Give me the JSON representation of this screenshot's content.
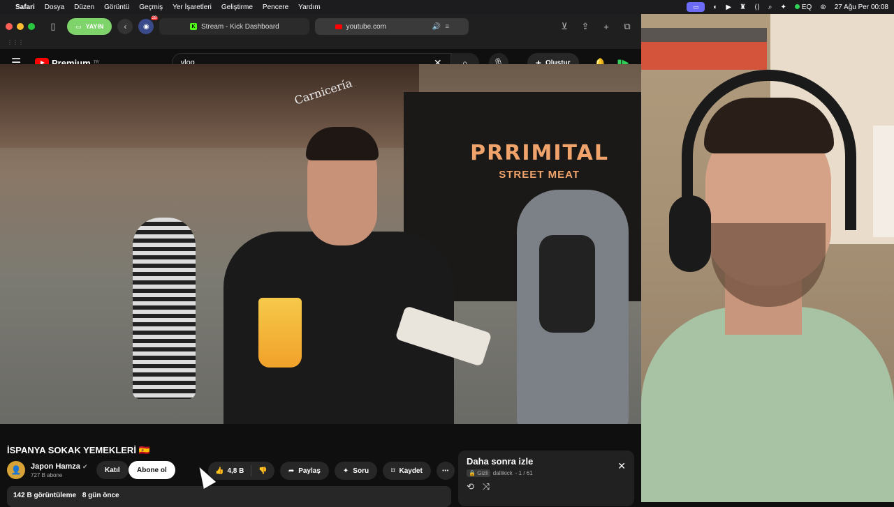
{
  "menubar": {
    "app": "Safari",
    "items": [
      "Dosya",
      "Düzen",
      "Görüntü",
      "Geçmiş",
      "Yer İşaretleri",
      "Geliştirme",
      "Pencere",
      "Yardım"
    ],
    "eq": "EQ",
    "datetime": "27 Ağu Per  00:08"
  },
  "browser": {
    "yayin_label": "YAYIN",
    "ext_badge": "28",
    "tabs": [
      {
        "label": "Stream - Kick Dashboard",
        "icon": "kick-icon"
      },
      {
        "label": "youtube.com",
        "icon": "youtube-icon"
      }
    ]
  },
  "youtube": {
    "logo_text": "Premium",
    "logo_region": "TR",
    "search_value": "vlog",
    "create_label": "Oluştur"
  },
  "video": {
    "sign_main": "PRRIMITAL",
    "sign_sub": "STREET MEAT",
    "shop_sign": "Carnicería",
    "title": "İSPANYA SOKAK YEMEKLERİ 🇪🇸",
    "channel_name": "Japon Hamza",
    "channel_subs": "727 B abone",
    "join_label": "Katıl",
    "subscribe_label": "Abone ol",
    "like_count": "4,8 B",
    "share_label": "Paylaş",
    "ask_label": "Soru",
    "save_label": "Kaydet",
    "views": "142 B görüntüleme",
    "age": "8 gün önce"
  },
  "watch_later": {
    "title": "Daha sonra izle",
    "privacy": "Gizli",
    "owner": "dallikick",
    "position": "- 1 / 61"
  },
  "colors": {
    "accent": "#ff0000",
    "yayin": "#7ed36b",
    "kick": "#53fc18"
  }
}
